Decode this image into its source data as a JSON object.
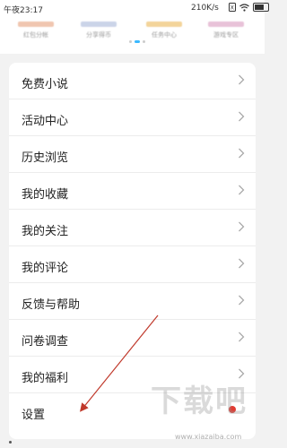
{
  "status_bar": {
    "time": "午夜23:17",
    "network_speed": "210K/s"
  },
  "banner": {
    "items": [
      {
        "label": "红包分帐",
        "color": "#f0c6b0"
      },
      {
        "label": "分享得币",
        "color": "#cbd4e8"
      },
      {
        "label": "任务中心",
        "color": "#f3d49a"
      },
      {
        "label": "游戏专区",
        "color": "#e8c2d8"
      }
    ],
    "active_page": 1,
    "page_count": 3
  },
  "menu": {
    "items": [
      {
        "label": "免费小说"
      },
      {
        "label": "活动中心"
      },
      {
        "label": "历史浏览"
      },
      {
        "label": "我的收藏"
      },
      {
        "label": "我的关注"
      },
      {
        "label": "我的评论"
      },
      {
        "label": "反馈与帮助"
      },
      {
        "label": "问卷调查"
      },
      {
        "label": "我的福利"
      },
      {
        "label": "设置"
      }
    ]
  },
  "watermark": {
    "text": "下载吧",
    "url": "www.xiazaiba.com"
  },
  "colors": {
    "accent": "#3bb9ff",
    "arrow": "#c0392b",
    "notification_dot": "#e03b32"
  }
}
